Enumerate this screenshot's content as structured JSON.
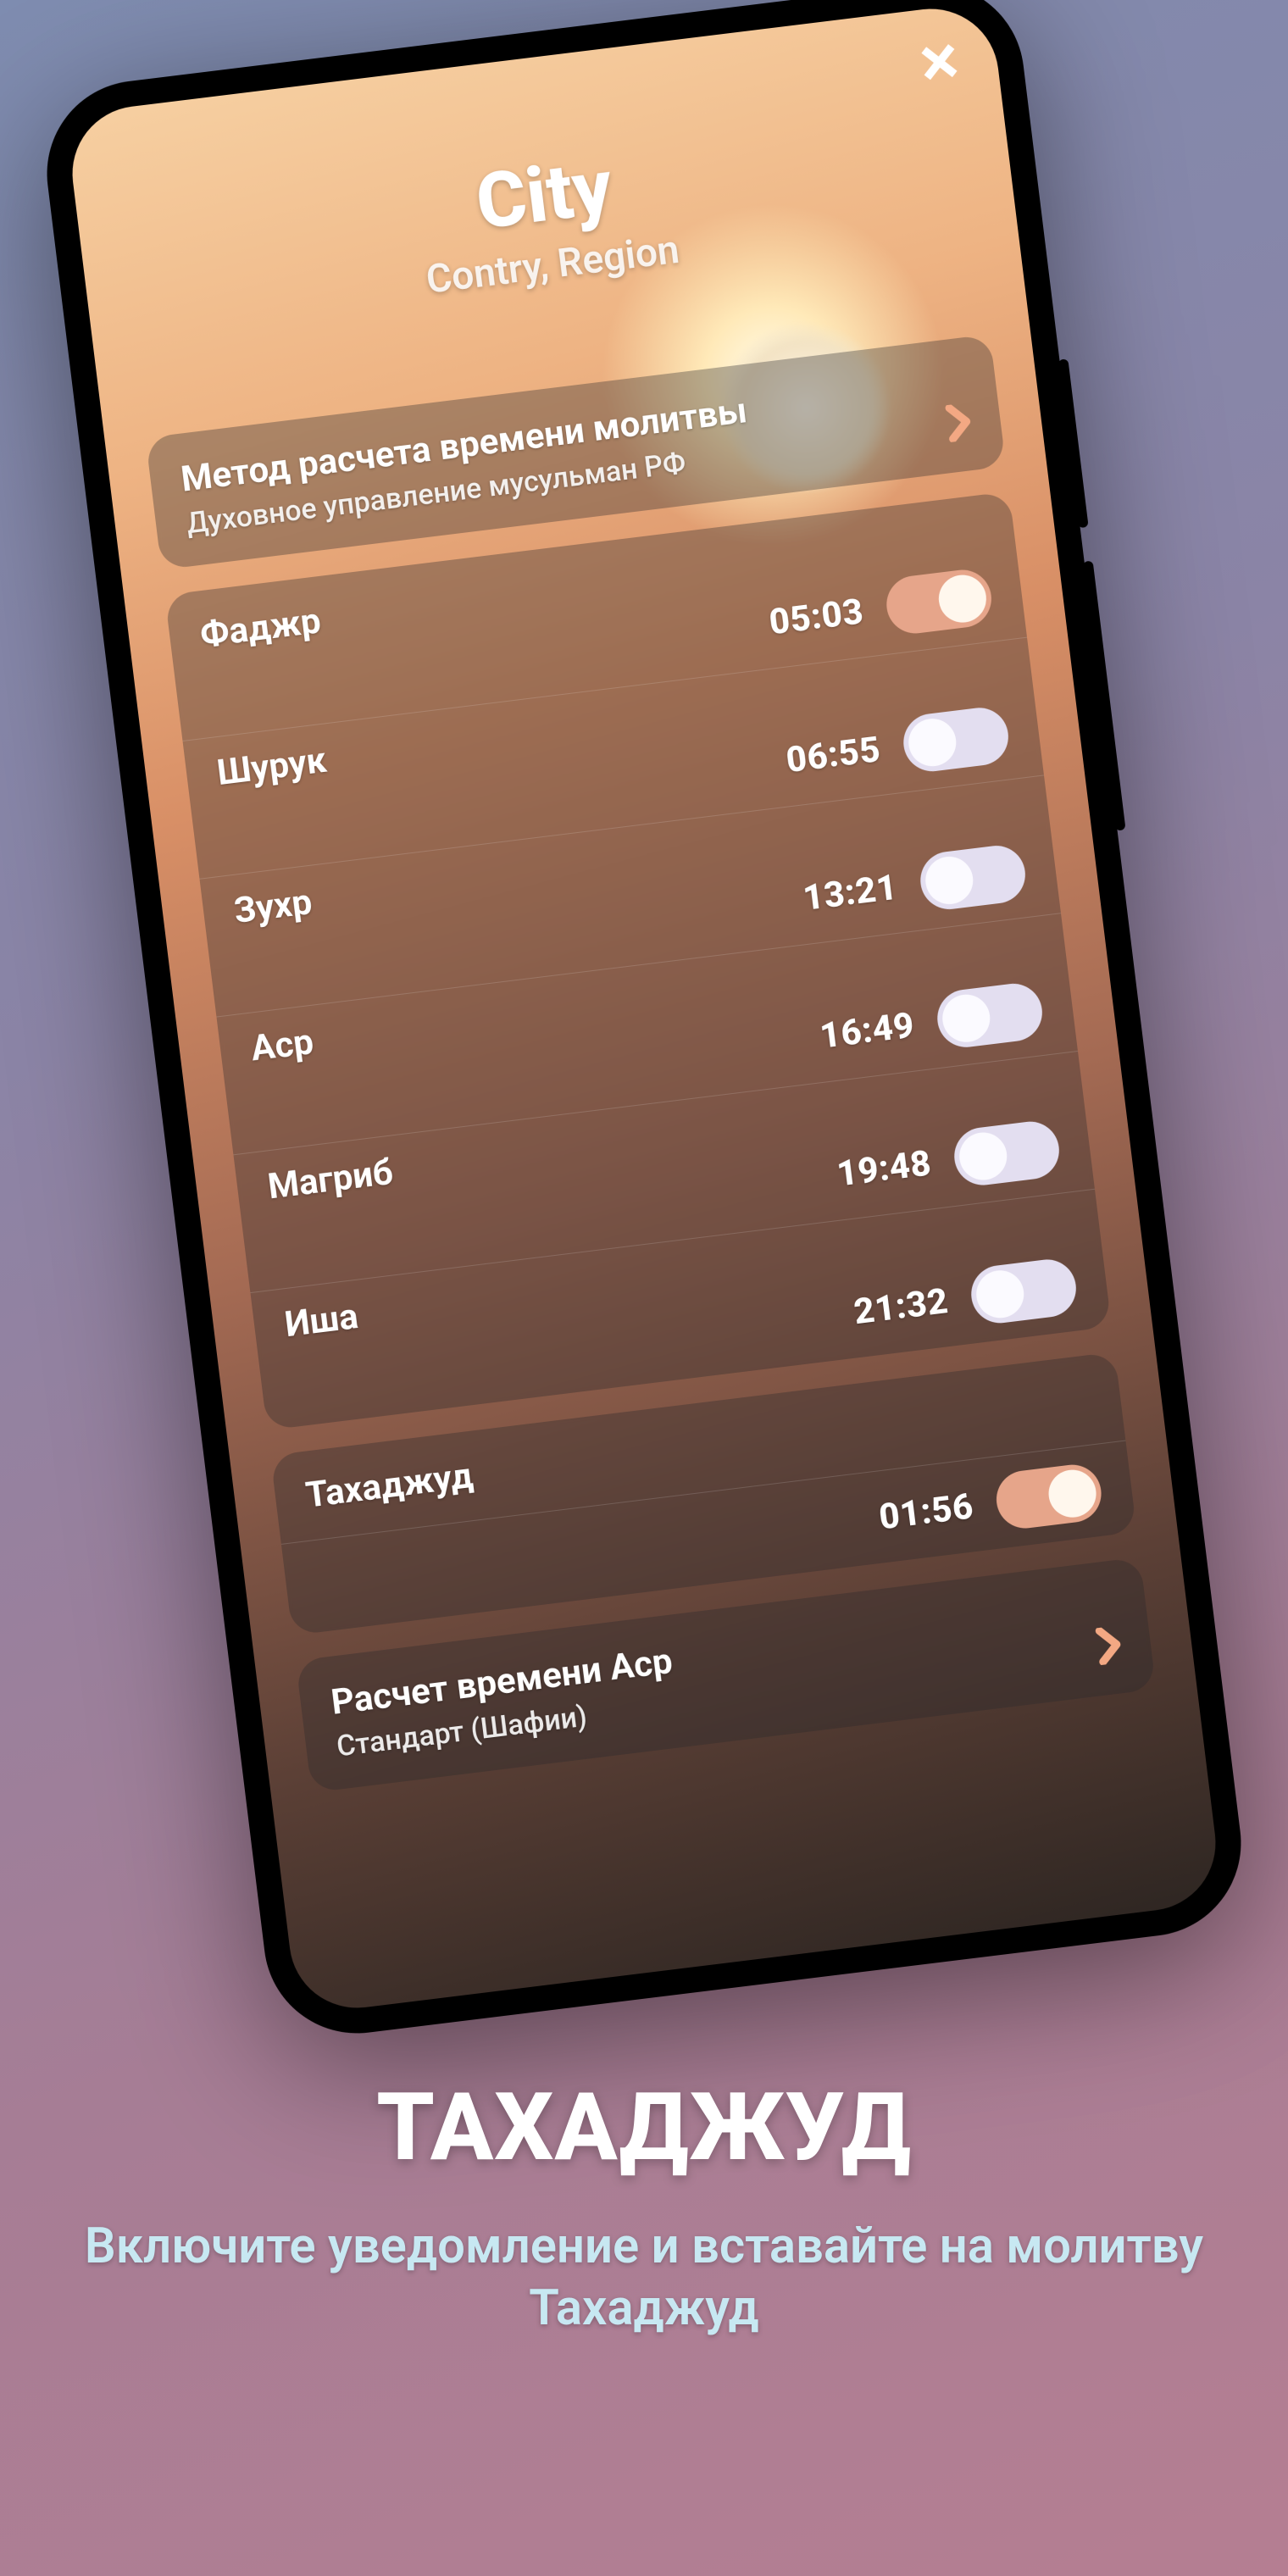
{
  "header": {
    "city": "City",
    "region": "Contry, Region"
  },
  "close_icon": "close",
  "method": {
    "title": "Метод расчета времени молитвы",
    "value": "Духовное управление мусульман РФ"
  },
  "prayers": [
    {
      "name": "Фаджр",
      "time": "05:03",
      "on": true
    },
    {
      "name": "Шурук",
      "time": "06:55",
      "on": false
    },
    {
      "name": "Зухр",
      "time": "13:21",
      "on": false
    },
    {
      "name": "Аср",
      "time": "16:49",
      "on": false
    },
    {
      "name": "Магриб",
      "time": "19:48",
      "on": false
    },
    {
      "name": "Иша",
      "time": "21:32",
      "on": false
    }
  ],
  "tahajjud": {
    "name": "Тахаджуд",
    "time": "01:56",
    "on": true
  },
  "asr": {
    "title": "Расчет времени Аср",
    "value": "Стандарт (Шафии)"
  },
  "promo": {
    "title": "ТАХАДЖУД",
    "subtitle": "Включите уведомление и вставайте на молитву Тахаджуд"
  }
}
